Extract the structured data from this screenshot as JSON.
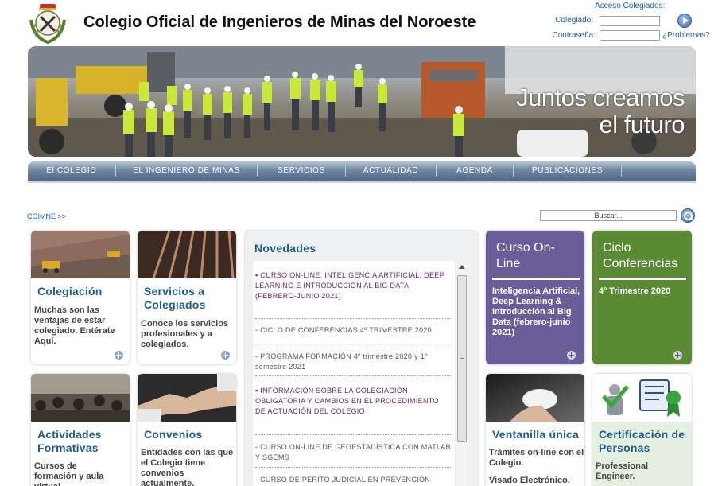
{
  "header": {
    "title": "Colegio Oficial de Ingenieros de Minas del Noroeste"
  },
  "login": {
    "title": "Acceso Colegiados:",
    "user_label": "Colegiado:",
    "password_label": "Contraseña:",
    "problems_link": "¿Problemas?"
  },
  "banner": {
    "slogan_line1": "Juntos creamos",
    "slogan_line2": "el futuro"
  },
  "nav": {
    "items": [
      "El COLEGIO",
      "EL INGENIERO DE MINAS",
      "SERVICIOS",
      "ACTUALIDAD",
      "AGENDA",
      "PUBLICACIONES"
    ]
  },
  "breadcrumb": {
    "root": "COIMNE",
    "separator": ">>"
  },
  "search": {
    "placeholder": "Buscar..."
  },
  "cards": {
    "colegiacion": {
      "title": "Colegiación",
      "text": "Muchas son las ventajas de estar colegiado. Entérate Aquí."
    },
    "servicios": {
      "title": "Servicios a Colegiados",
      "text": "Conoce los servicios profesionales y a colegiados."
    },
    "actividades": {
      "title": "Actividades Formativas",
      "text": "Cursos de formación y aula virtual"
    },
    "convenios": {
      "title": "Convenios",
      "text": "Entidades con las que el Colegio tiene convenios actualmente."
    },
    "curso": {
      "title": "Curso On-Line",
      "text": "Inteligencia Artificial, Deep Learning & Introducción al Big Data (febrero-junio 2021)"
    },
    "ciclo": {
      "title": "Ciclo Conferencias",
      "text": "4º Trimestre 2020"
    },
    "ventanilla": {
      "title": "Ventanilla única",
      "text1": "Trámites on-line con el Colegio.",
      "text2": "Visado Electrónico."
    },
    "certificacion": {
      "title": "Certificación de Personas",
      "text": "Professional Engineer."
    }
  },
  "novedades": {
    "title": "Novedades",
    "items": [
      {
        "text": "CURSO ON-LINE: INTELIGENCIA ARTIFICIAL, DEEP LEARNING E INTRODUCCIÓN AL BIG DATA (FEBRERO-JUNIO 2021)",
        "highlight": true
      },
      {
        "text": "CICLO DE CONFERENCIAS 4º TRIMESTRE 2020",
        "highlight": false
      },
      {
        "text": "PROGRAMA FORMACIÓN 4º trimestre 2020 y 1º semestre 2021",
        "highlight": false
      },
      {
        "text": "INFORMACIÓN SOBRE LA COLEGIACIÓN OBLIGATORIA Y CAMBIOS EN EL PROCEDIMIENTO DE ACTUACIÓN DEL COLEGIO",
        "highlight": true
      },
      {
        "text": "CURSO ON-LINE DE GEOESTADÍSTICA CON MATLAB Y SGEMS",
        "highlight": false
      },
      {
        "text": "CURSO DE PERITO JUDICIAL EN PREVENCIÓN",
        "highlight": false
      }
    ]
  },
  "colors": {
    "brand_blue": "#1d5b8e",
    "nav_blue": "#5a7391",
    "purple": "#6b5d9a",
    "green": "#5a8a34"
  }
}
